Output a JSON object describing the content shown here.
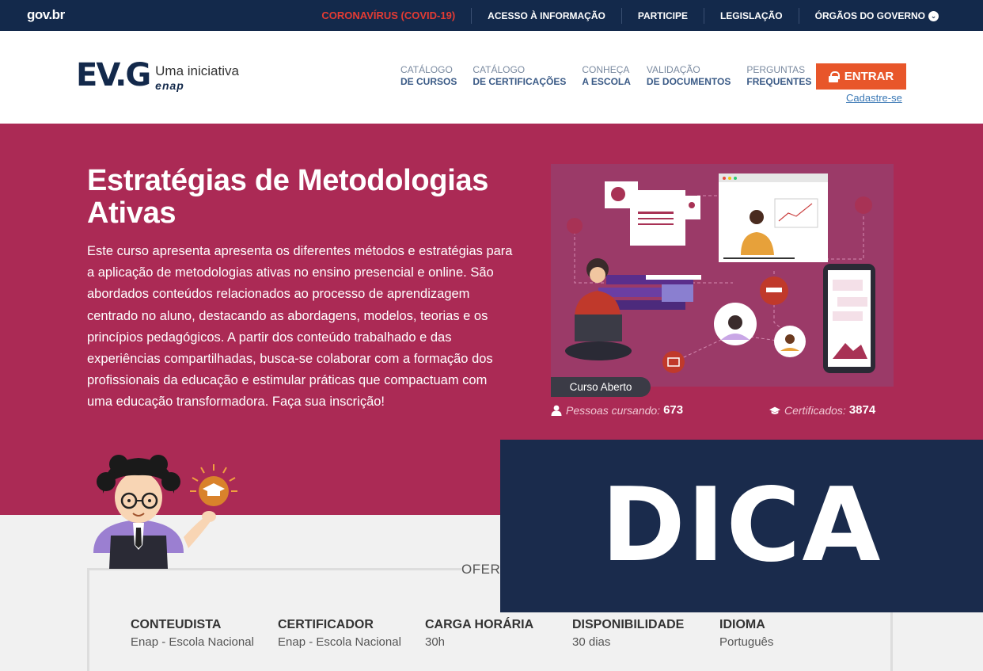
{
  "govbar": {
    "logo": "gov.br",
    "links": [
      "CORONAVÍRUS (COVID-19)",
      "ACESSO À INFORMAÇÃO",
      "PARTICIPE",
      "LEGISLAÇÃO",
      "ÓRGÃOS DO GOVERNO"
    ],
    "chevron": "⌄"
  },
  "brand": {
    "mark": "EV.G",
    "tagline": "Uma iniciativa",
    "org": "enap"
  },
  "nav": [
    {
      "l1": "CATÁLOGO",
      "l2": "DE CURSOS"
    },
    {
      "l1": "CATÁLOGO",
      "l2": "DE CERTIFICAÇÕES"
    },
    {
      "l1": "CONHEÇA",
      "l2": "A ESCOLA"
    },
    {
      "l1": "VALIDAÇÃO",
      "l2": "DE DOCUMENTOS"
    },
    {
      "l1": "PERGUNTAS",
      "l2": "FREQUENTES"
    }
  ],
  "entrar_label": "ENTRAR",
  "cadastre_label": "Cadastre-se",
  "hero": {
    "title": "Estratégias de Metodologias Ativas",
    "description": "Este curso apresenta apresenta os diferentes métodos e estratégias para a aplicação de metodologias ativas no ensino presencial e online. São abordados conteúdos relacionados ao processo de aprendizagem centrado no aluno, destacando as abordagens, modelos, teorias e os princípios pedagógicos. A partir dos conteúdo trabalhado e das experiências compartilhadas, busca-se colaborar com a formação dos profissionais da educação e estimular práticas que compactuam com uma educação transformadora. Faça sua inscrição!",
    "badge": "Curso Aberto",
    "stats": {
      "pessoas_label": "Pessoas cursando:",
      "pessoas_value": "673",
      "cert_label": "Certificados:",
      "cert_value": "3874"
    }
  },
  "offer_title": "OFER",
  "info": [
    {
      "h": "CONTEUDISTA",
      "v": "Enap - Escola Nacional"
    },
    {
      "h": "CERTIFICADOR",
      "v": "Enap - Escola Nacional"
    },
    {
      "h": "CARGA HORÁRIA",
      "v": "30h"
    },
    {
      "h": "DISPONIBILIDADE",
      "v": "30 dias"
    },
    {
      "h": "IDIOMA",
      "v": "Português"
    }
  ],
  "overlay": "DICA",
  "colors": {
    "govbar": "#13294b",
    "hero": "#ab2a55",
    "accent": "#e8562a",
    "overlay": "#1a2b4c"
  },
  "icons": [
    "lock-icon",
    "person-icon",
    "graduation-cap-icon",
    "chevron-down-icon"
  ]
}
